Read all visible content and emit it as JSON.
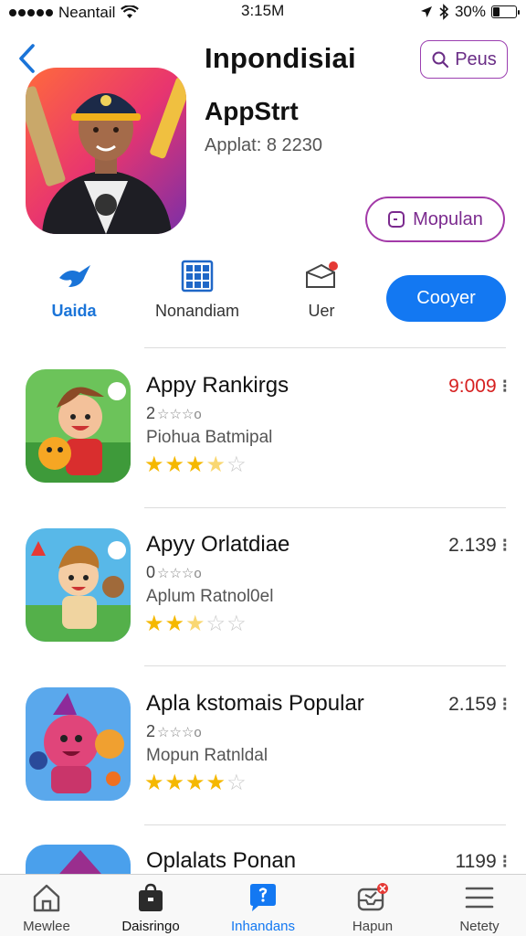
{
  "status_bar": {
    "carrier": "Neantail",
    "time": "3:15M",
    "battery": "30%",
    "battery_level": 0.3
  },
  "header": {
    "title": "Inpondisiai",
    "search_label": "Peus"
  },
  "app": {
    "name": "AppStrt",
    "subtitle": "Applat: 8 2230",
    "popular_label": "Mopulan"
  },
  "actions": {
    "a": {
      "label": "Uaida",
      "icon": "bird-icon"
    },
    "b": {
      "label": "Nonandiam",
      "icon": "grid-icon"
    },
    "c": {
      "label": "Uer",
      "icon": "box-badge-icon"
    },
    "primary": "Cooyer"
  },
  "list": [
    {
      "title": "Appy Rankirgs",
      "count": "2",
      "count_stars": "☆☆☆o",
      "sub": "Piohua Batmipal",
      "rating": 3.5,
      "price": "9:009",
      "price_color": "#d62020"
    },
    {
      "title": "Apyy Orlatdiae",
      "count": "0",
      "count_stars": "☆☆☆o",
      "sub": "Aplum Ratnol0el",
      "rating": 2.5,
      "price": "2.139",
      "price_color": "#333333"
    },
    {
      "title": "Apla kstomais Popular",
      "count": "2",
      "count_stars": "☆☆☆o",
      "sub": "Mopun Ratnldal",
      "rating": 4,
      "price": "2.159",
      "price_color": "#333333"
    },
    {
      "title": "Oplalats Ponan",
      "count": "",
      "count_stars": "",
      "sub": "",
      "rating": 0,
      "price": "1199",
      "price_color": "#333333"
    }
  ],
  "tabs": [
    {
      "label": "Mewlee",
      "icon": "home-icon"
    },
    {
      "label": "Daisringo",
      "icon": "bag-icon"
    },
    {
      "label": "Inhandans",
      "icon": "chat-icon"
    },
    {
      "label": "Hapun",
      "icon": "inbox-icon"
    },
    {
      "label": "Netety",
      "icon": "menu-icon"
    }
  ],
  "colors": {
    "accent": "#1378f2",
    "purple": "#a33aa8",
    "star": "#f5b800"
  }
}
